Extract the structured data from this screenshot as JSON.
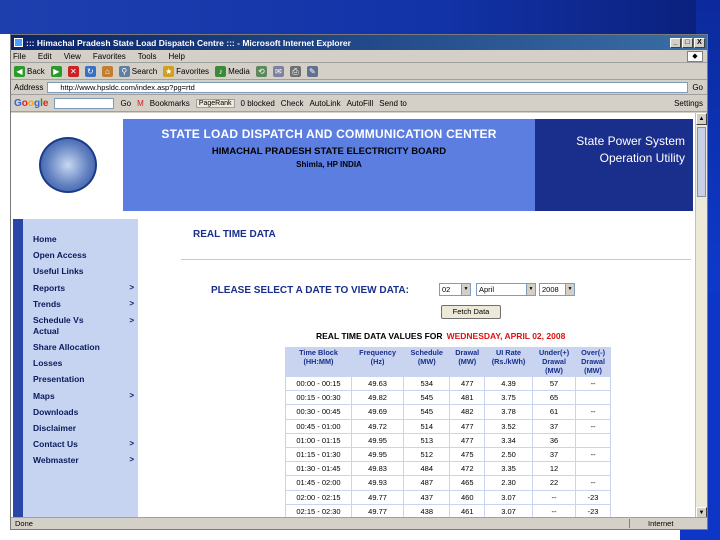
{
  "window": {
    "title": "::: Himachal Pradesh State Load Dispatch Centre ::: - Microsoft Internet Explorer",
    "controls": [
      "_",
      "□",
      "X"
    ]
  },
  "menubar": [
    "File",
    "Edit",
    "View",
    "Favorites",
    "Tools",
    "Help"
  ],
  "toolbar": {
    "back": "Back",
    "search": "Search",
    "favorites": "Favorites",
    "media": "Media"
  },
  "addressbar": {
    "label": "Address",
    "url": "http://www.hpsldc.com/index.asp?pg=rtd",
    "go": "Go"
  },
  "googlebar": {
    "logo": [
      "G",
      "o",
      "o",
      "g",
      "l",
      "e"
    ],
    "go": "Go",
    "bookmarks": "Bookmarks",
    "pagerank": "PageRank",
    "blocked": "0 blocked",
    "check": "Check",
    "autolink": "AutoLink",
    "autofill": "AutoFill",
    "sendto": "Send to",
    "settings": "Settings"
  },
  "header": {
    "title": "STATE LOAD DISPATCH AND COMMUNICATION CENTER",
    "subtitle": "HIMACHAL PRADESH STATE ELECTRICITY BOARD",
    "location": "Shimla, HP INDIA",
    "right_line1": "State Power System",
    "right_line2": "Operation Utility"
  },
  "nav": [
    {
      "label": "Home",
      "arrow": ""
    },
    {
      "label": "Open Access",
      "arrow": ""
    },
    {
      "label": "Useful Links",
      "arrow": ""
    },
    {
      "label": "Reports",
      "arrow": ">"
    },
    {
      "label": "Trends",
      "arrow": ">"
    },
    {
      "label": "Schedule Vs Actual",
      "arrow": ">"
    },
    {
      "label": "Share Allocation",
      "arrow": ""
    },
    {
      "label": "Losses",
      "arrow": ""
    },
    {
      "label": "Presentation",
      "arrow": ""
    },
    {
      "label": "Maps",
      "arrow": ">"
    },
    {
      "label": "Downloads",
      "arrow": ""
    },
    {
      "label": "Disclaimer",
      "arrow": ""
    },
    {
      "label": "Contact Us",
      "arrow": ">"
    },
    {
      "label": "Webmaster",
      "arrow": ">"
    }
  ],
  "content": {
    "heading": "REAL TIME DATA",
    "select_label": "PLEASE SELECT A DATE TO VIEW DATA:",
    "day": "02",
    "month": "April",
    "year": "2008",
    "fetch": "Fetch Data",
    "values_title": "REAL TIME DATA VALUES FOR",
    "values_date": "WEDNESDAY, APRIL 02, 2008"
  },
  "table": {
    "headers": [
      [
        "Time Block",
        "(HH:MM)"
      ],
      [
        "Frequency",
        "(Hz)"
      ],
      [
        "Schedule",
        "(MW)"
      ],
      [
        "Drawal",
        "(MW)"
      ],
      [
        "UI Rate",
        "(Rs./kWh)"
      ],
      [
        "Under(+)",
        "Drawal",
        "(MW)"
      ],
      [
        "Over(-)",
        "Drawal",
        "(MW)"
      ]
    ],
    "rows": [
      [
        "00:00 - 00:15",
        "49.63",
        "534",
        "477",
        "4.39",
        "57",
        "--"
      ],
      [
        "00:15 - 00:30",
        "49.82",
        "545",
        "481",
        "3.75",
        "65",
        ""
      ],
      [
        "00:30 - 00:45",
        "49.69",
        "545",
        "482",
        "3.78",
        "61",
        "--"
      ],
      [
        "00:45 - 01:00",
        "49.72",
        "514",
        "477",
        "3.52",
        "37",
        "--"
      ],
      [
        "01:00 - 01:15",
        "49.95",
        "513",
        "477",
        "3.34",
        "36",
        ""
      ],
      [
        "01:15 - 01:30",
        "49.95",
        "512",
        "475",
        "2.50",
        "37",
        "--"
      ],
      [
        "01:30 - 01:45",
        "49.83",
        "484",
        "472",
        "3.35",
        "12",
        ""
      ],
      [
        "01:45 - 02:00",
        "49.93",
        "487",
        "465",
        "2.30",
        "22",
        "--"
      ],
      [
        "02:00 - 02:15",
        "49.77",
        "437",
        "460",
        "3.07",
        "--",
        "-23"
      ],
      [
        "02:15 - 02:30",
        "49.77",
        "438",
        "461",
        "3.07",
        "--",
        "-23"
      ]
    ]
  },
  "statusbar": {
    "status": "Done",
    "zone": "Internet"
  }
}
